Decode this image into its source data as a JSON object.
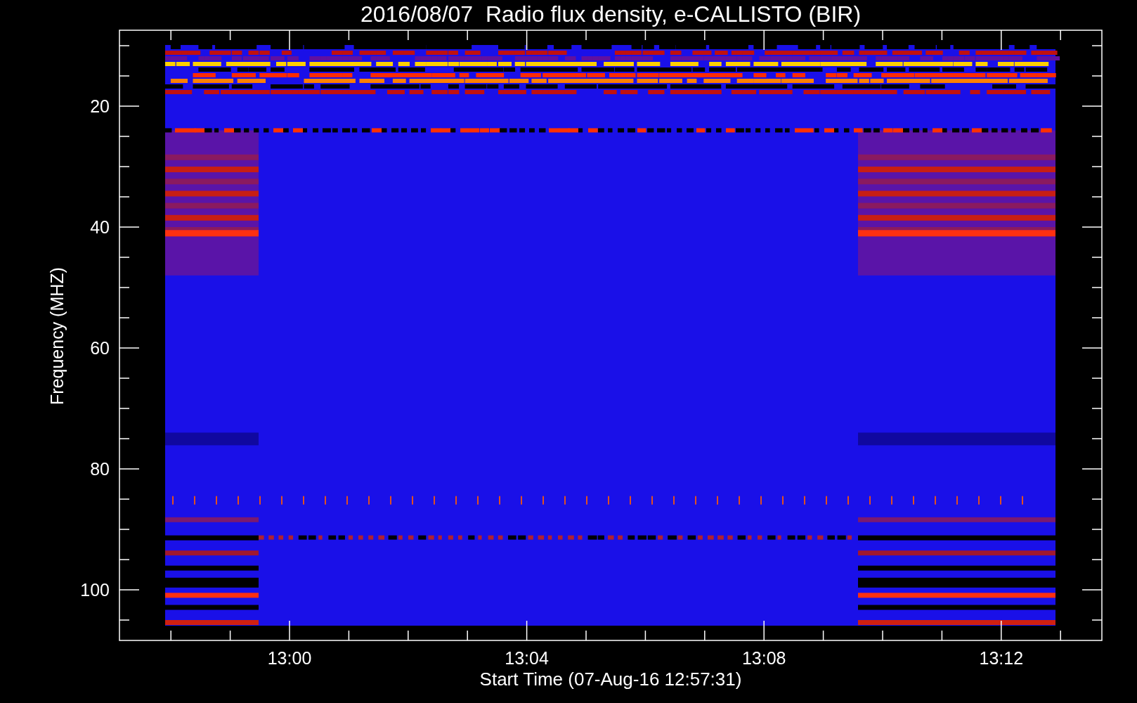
{
  "title": "2016/08/07  Radio flux density, e-CALLISTO (BIR)",
  "y_axis": {
    "label": "Frequency (MHZ)",
    "ticks": [
      "20",
      "40",
      "60",
      "80",
      "100"
    ]
  },
  "x_axis": {
    "label": "Start Time (07-Aug-16 12:57:31)",
    "ticks": [
      "13:00",
      "13:04",
      "13:08",
      "13:12"
    ]
  }
}
